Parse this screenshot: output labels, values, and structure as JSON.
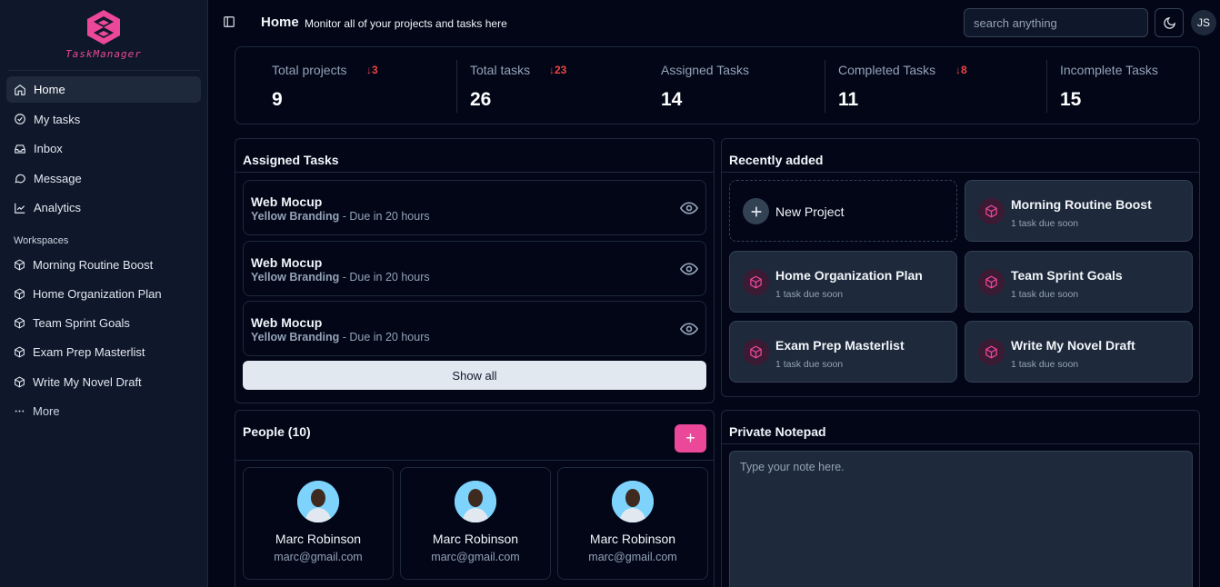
{
  "app": {
    "logo_text": "TaskManager",
    "brand_color": "#ec4899"
  },
  "sidebar": {
    "nav": [
      {
        "label": "Home",
        "icon": "home-icon",
        "active": true
      },
      {
        "label": "My tasks",
        "icon": "check-circle-icon"
      },
      {
        "label": "Inbox",
        "icon": "inbox-icon"
      },
      {
        "label": "Message",
        "icon": "message-icon"
      },
      {
        "label": "Analytics",
        "icon": "chart-line-icon"
      }
    ],
    "workspaces_title": "Workspaces",
    "workspaces": [
      {
        "label": "Morning Routine Boost",
        "icon": "box-icon"
      },
      {
        "label": "Home Organization Plan",
        "icon": "box-icon"
      },
      {
        "label": "Team Sprint Goals",
        "icon": "box-icon"
      },
      {
        "label": "Exam Prep Masterlist",
        "icon": "box-icon"
      },
      {
        "label": "Write My Novel Draft",
        "icon": "box-icon"
      }
    ],
    "more_label": "More"
  },
  "header": {
    "title": "Home",
    "subtitle": "Monitor all of your projects and tasks here",
    "search_placeholder": "search anything",
    "user_initials": "JS"
  },
  "stats": [
    {
      "label": "Total projects",
      "delta": "3",
      "value": "9"
    },
    {
      "label": "Total tasks",
      "delta": "23",
      "value": "26"
    },
    {
      "label": "Assigned Tasks",
      "delta": "",
      "value": "14"
    },
    {
      "label": "Completed Tasks",
      "delta": "8",
      "value": "11"
    },
    {
      "label": "Incomplete Tasks",
      "delta": "",
      "value": "15"
    }
  ],
  "assigned": {
    "title": "Assigned Tasks",
    "tasks": [
      {
        "name": "Web Mocup",
        "project": "Yellow Branding",
        "due": " - Due in 20 hours"
      },
      {
        "name": "Web Mocup",
        "project": "Yellow Branding",
        "due": " - Due in 20 hours"
      },
      {
        "name": "Web Mocup",
        "project": "Yellow Branding",
        "due": " - Due in 20 hours"
      }
    ],
    "show_all_label": "Show all"
  },
  "recent": {
    "title": "Recently added",
    "new_project_label": "New Project",
    "projects": [
      {
        "name": "Morning Routine Boost",
        "meta": "1 task due soon"
      },
      {
        "name": "Home Organization Plan",
        "meta": "1 task due soon"
      },
      {
        "name": "Team Sprint Goals",
        "meta": "1 task due soon"
      },
      {
        "name": "Exam Prep Masterlist",
        "meta": "1 task due soon"
      },
      {
        "name": "Write My Novel Draft",
        "meta": "1 task due soon"
      }
    ]
  },
  "people": {
    "title": "People (10)",
    "add_label": "+",
    "list": [
      {
        "name": "Marc Robinson",
        "email": "marc@gmail.com"
      },
      {
        "name": "Marc Robinson",
        "email": "marc@gmail.com"
      },
      {
        "name": "Marc Robinson",
        "email": "marc@gmail.com"
      }
    ]
  },
  "notepad": {
    "title": "Private Notepad",
    "placeholder": "Type your note here."
  }
}
